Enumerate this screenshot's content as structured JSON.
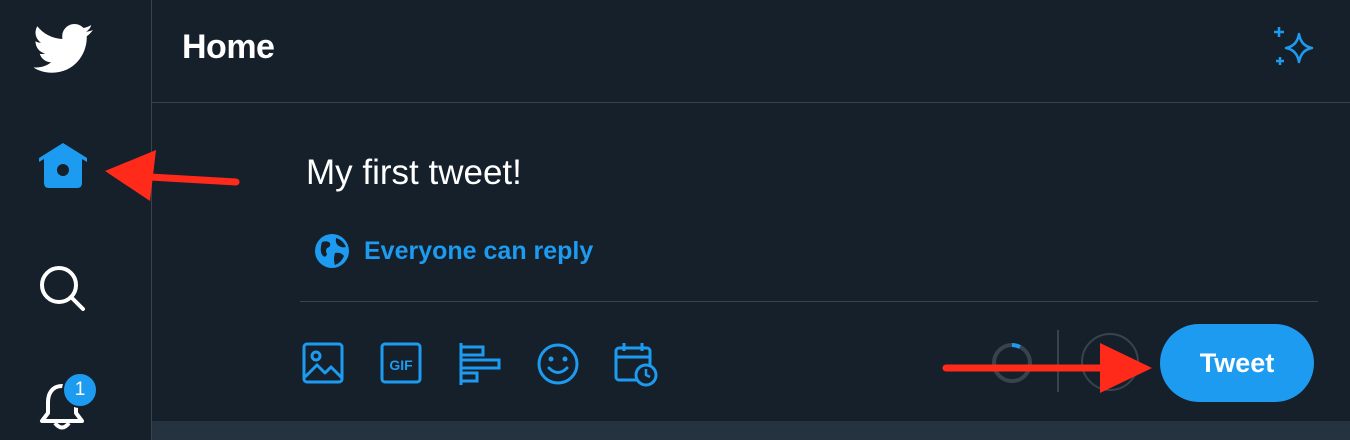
{
  "header": {
    "title": "Home"
  },
  "sidebar": {
    "items": [
      {
        "name": "logo",
        "icon": "twitter-bird-icon"
      },
      {
        "name": "home",
        "icon": "home-icon",
        "active": true
      },
      {
        "name": "explore",
        "icon": "search-icon"
      },
      {
        "name": "notifications",
        "icon": "bell-icon",
        "badge": "1"
      }
    ]
  },
  "composer": {
    "text": "My first tweet!",
    "reply_setting": "Everyone can reply",
    "toolbar": [
      "image-icon",
      "gif-icon",
      "poll-icon",
      "emoji-icon",
      "schedule-icon"
    ],
    "tweet_button": "Tweet"
  },
  "colors": {
    "background": "#15202b",
    "accent": "#1d9bf0",
    "border": "#38444d",
    "annotation": "#ff2a1a"
  },
  "annotations": [
    {
      "type": "arrow",
      "target": "home-icon"
    },
    {
      "type": "arrow",
      "target": "tweet-button"
    }
  ]
}
